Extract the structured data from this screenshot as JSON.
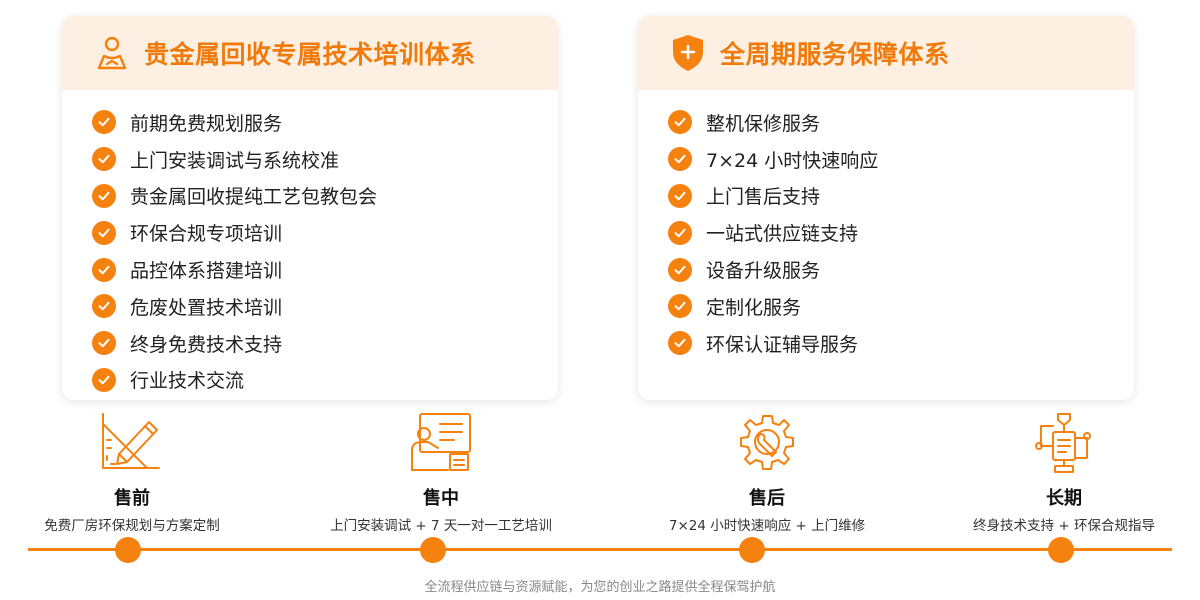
{
  "colors": {
    "accent": "#f5810f",
    "header_bg": "#fdf0e2",
    "title": "#f07a0c"
  },
  "training_card": {
    "icon": "person-icon",
    "title": "贵金属回收专属技术培训体系",
    "items": [
      "前期免费规划服务",
      "上门安装调试与系统校准",
      "贵金属回收提纯工艺包教包会",
      "环保合规专项培训",
      "品控体系搭建培训",
      "危废处置技术培训",
      "终身免费技术支持",
      "行业技术交流"
    ]
  },
  "service_card": {
    "icon": "shield-plus-icon",
    "title": "全周期服务保障体系",
    "items": [
      "整机保修服务",
      "7×24 小时快速响应",
      "上门售后支持",
      "一站式供应链支持",
      "设备升级服务",
      "定制化服务",
      "环保认证辅导服务"
    ]
  },
  "stages": [
    {
      "icon": "ruler-pencil-icon",
      "name": "售前",
      "desc": "免费厂房环保规划与方案定制"
    },
    {
      "icon": "teacher-screen-icon",
      "name": "售中",
      "desc": "上门安装调试 + 7 天一对一工艺培训"
    },
    {
      "icon": "gear-wrench-icon",
      "name": "售后",
      "desc": "7×24 小时快速响应 + 上门维修"
    },
    {
      "icon": "flow-process-icon",
      "name": "长期",
      "desc": "终身技术支持 + 环保合规指导"
    }
  ],
  "footer": "全流程供应链与资源赋能，为您的创业之路提供全程保驾护航"
}
